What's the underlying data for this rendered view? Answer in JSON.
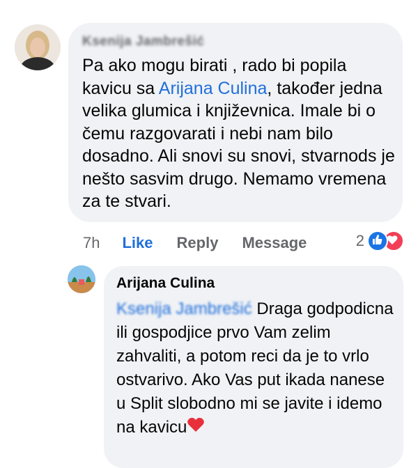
{
  "comment": {
    "author_name": "Ksenija Jambrešić",
    "text_before_mention": "Pa ako mogu birati , rado bi popila kavicu sa ",
    "mention": "Arijana Culina",
    "text_after_mention": ", također jedna velika glumica i književnica. Imale bi o čemu razgovarati i nebi nam bilo dosadno. Ali snovi su snovi, stvarnods je nešto sasvim drugo. Nemamo vremena za te stvari.",
    "time": "7h",
    "like_label": "Like",
    "reply_label": "Reply",
    "message_label": "Message",
    "reaction_count": "2"
  },
  "reply": {
    "author_name": "Arijana Culina",
    "mention": "Ksenija Jambrešić",
    "text": "Draga godpodicna ili gospodjice prvo Vam zelim zahvaliti, a potom reci da je to vrlo ostvarivo. Ako Vas put ikada nanese u Split slobodno mi se javite i idemo na kavicu"
  },
  "colors": {
    "link_blue": "#216fdb",
    "bubble_bg": "#f0f2f5",
    "meta_gray": "#65676b",
    "like_reaction": "#1b74e4",
    "love_reaction": "#f33e58"
  },
  "icons": [
    "like-reaction-icon",
    "love-reaction-icon",
    "heart-emoji-icon"
  ]
}
